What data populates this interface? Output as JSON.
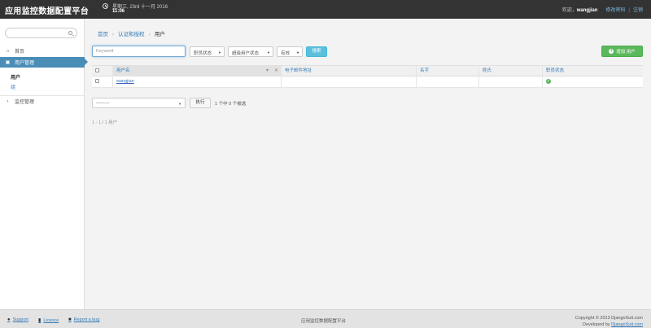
{
  "header": {
    "brand": "应用监控数据配置平台",
    "date": "星期三, 23rd 十一月 2016",
    "time": "11:06",
    "welcome": "欢迎，",
    "username": "wangjian",
    "change_password": "修改密码",
    "separator": "|",
    "logout": "注销"
  },
  "sidebar": {
    "search_placeholder": "",
    "items": [
      {
        "label": "首页",
        "icon": "home-icon"
      },
      {
        "label": "用户管理",
        "icon": "lock-icon"
      },
      {
        "label": "监控管理",
        "icon": "chevron-right-icon"
      }
    ],
    "sub_items": [
      {
        "label": "用户"
      },
      {
        "label": "组"
      }
    ]
  },
  "breadcrumb": {
    "home": "首页",
    "auth": "认证和授权",
    "current": "用户",
    "sep": "›"
  },
  "filters": {
    "keyword_placeholder": "Keyword",
    "staff_status": "职员状态",
    "superuser_status": "超级用户状态",
    "active": "有效",
    "search_button": "搜索",
    "add_button": "增加 用户"
  },
  "table": {
    "columns": [
      "用户名",
      "电子邮件地址",
      "名字",
      "姓氏",
      "职员状态"
    ],
    "rows": [
      {
        "username": "wangjian",
        "email": "",
        "first_name": "",
        "last_name": "",
        "staff": true
      }
    ]
  },
  "actions": {
    "select_value": "---------",
    "go_button": "执行",
    "selected_count": "1 个中 0 个被选"
  },
  "pagination": {
    "text": "1 - 1 / 1 用户"
  },
  "footer": {
    "support": "Support",
    "licence": "Licence",
    "report_bug": "Report a bug",
    "center": "应用监控数据配置平台",
    "copyright": "Copyright © 2013 DjangoSuit.com",
    "developed_by": "Developed by",
    "developer": "DjangoSuit.com"
  },
  "colors": {
    "header_bg": "#333333",
    "accent": "#4a8db7",
    "success": "#5cb85c",
    "info": "#5bc0de"
  }
}
